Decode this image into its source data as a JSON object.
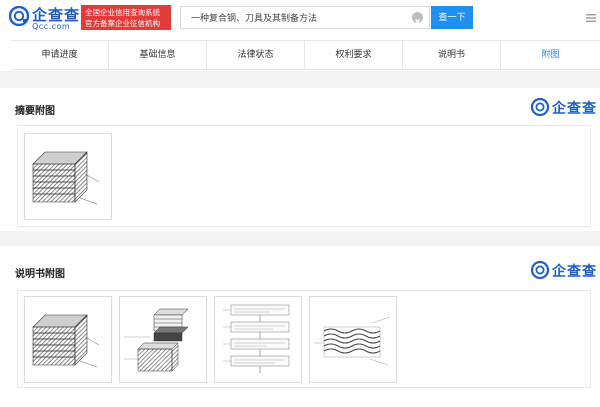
{
  "header": {
    "logo_name": "企查查",
    "logo_domain": "Qcc.com",
    "cert_line1": "全国企业信用查询系统",
    "cert_line2": "官方备案企业征信机构",
    "search_value": "一种复合钢、刀具及其制备方法",
    "search_button": "查一下"
  },
  "tabs": [
    {
      "label": "申请进度",
      "active": false
    },
    {
      "label": "基础信息",
      "active": false
    },
    {
      "label": "法律状态",
      "active": false
    },
    {
      "label": "权利要求",
      "active": false
    },
    {
      "label": "说明书",
      "active": false
    },
    {
      "label": "附图",
      "active": true
    }
  ],
  "sections": {
    "abstract": {
      "title": "摘要附图",
      "brand": "企查查"
    },
    "spec": {
      "title": "说明书附图",
      "brand": "企查查"
    }
  },
  "colors": {
    "brand_blue": "#1f5fc9",
    "search_button": "#1f8ff0",
    "cert_badge": "#e23b3b",
    "active_tab": "#3a7fe0"
  },
  "icons": [
    "logo-icon",
    "clear-icon",
    "menu-icon",
    "brand-logo-icon"
  ]
}
